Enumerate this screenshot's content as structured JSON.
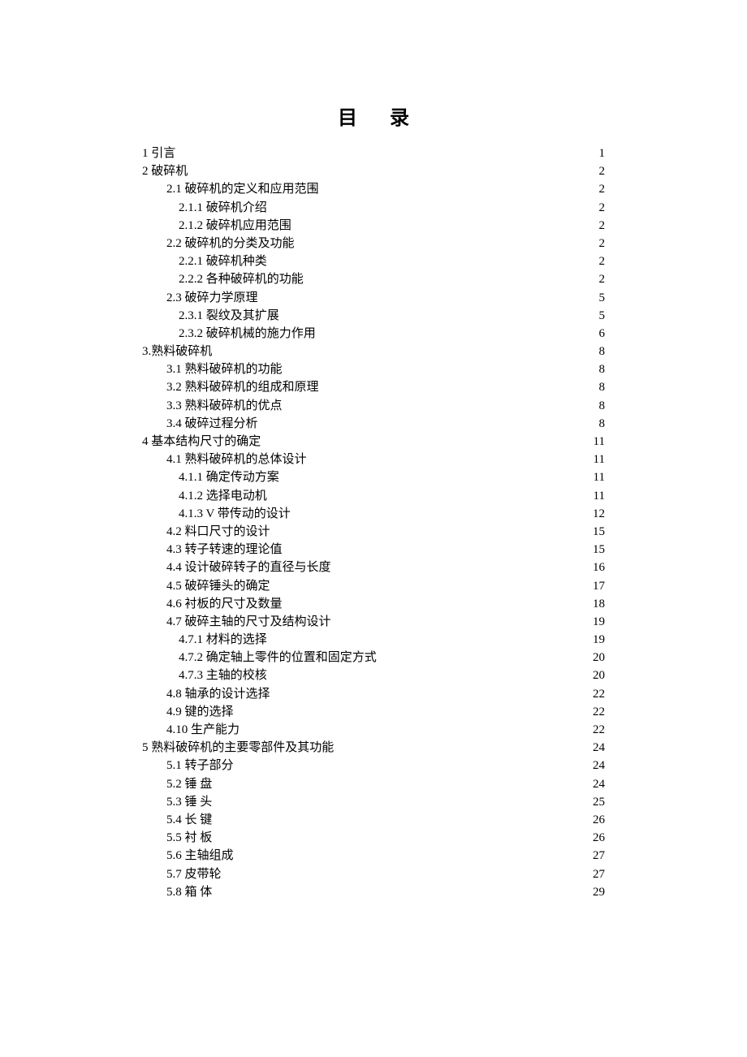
{
  "title": "目录",
  "entries": [
    {
      "level": 0,
      "label": "1 引言",
      "page": "1"
    },
    {
      "level": 0,
      "label": "2 破碎机",
      "page": "2"
    },
    {
      "level": 1,
      "label": "2.1 破碎机的定义和应用范围",
      "page": "2"
    },
    {
      "level": 2,
      "label": "2.1.1 破碎机介绍",
      "page": "2"
    },
    {
      "level": 2,
      "label": "2.1.2 破碎机应用范围",
      "page": "2"
    },
    {
      "level": 1,
      "label": "2.2 破碎机的分类及功能",
      "page": "2"
    },
    {
      "level": 2,
      "label": "2.2.1 破碎机种类",
      "page": "2"
    },
    {
      "level": 2,
      "label": "2.2.2 各种破碎机的功能",
      "page": "2"
    },
    {
      "level": 1,
      "label": "2.3 破碎力学原理",
      "page": "5"
    },
    {
      "level": 2,
      "label": "2.3.1 裂纹及其扩展",
      "page": "5"
    },
    {
      "level": 2,
      "label": "2.3.2 破碎机械的施力作用",
      "page": "6"
    },
    {
      "level": 0,
      "label": "3.熟料破碎机",
      "page": "8"
    },
    {
      "level": 1,
      "label": "3.1 熟料破碎机的功能",
      "page": "8"
    },
    {
      "level": 1,
      "label": "3.2 熟料破碎机的组成和原理",
      "page": "8"
    },
    {
      "level": 1,
      "label": "3.3 熟料破碎机的优点",
      "page": "8"
    },
    {
      "level": 1,
      "label": "3.4 破碎过程分析",
      "page": "8"
    },
    {
      "level": 0,
      "label": "4 基本结构尺寸的确定",
      "page": "11"
    },
    {
      "level": 1,
      "label": "4.1 熟料破碎机的总体设计",
      "page": "11"
    },
    {
      "level": 2,
      "label": "4.1.1  确定传动方案",
      "page": "11"
    },
    {
      "level": 2,
      "label": "4.1.2 选择电动机",
      "page": "11"
    },
    {
      "level": 2,
      "label": "4.1.3 V 带传动的设计",
      "page": "12"
    },
    {
      "level": 1,
      "label": "4.2 料口尺寸的设计",
      "page": "15"
    },
    {
      "level": 1,
      "label": "4.3 转子转速的理论值",
      "page": "15"
    },
    {
      "level": 1,
      "label": "4.4 设计破碎转子的直径与长度",
      "page": "16"
    },
    {
      "level": 1,
      "label": "4.5 破碎锤头的确定",
      "page": "17"
    },
    {
      "level": 1,
      "label": "4.6 衬板的尺寸及数量",
      "page": "18"
    },
    {
      "level": 1,
      "label": "4.7 破碎主轴的尺寸及结构设计",
      "page": "19"
    },
    {
      "level": 2,
      "label": "4.7.1 材料的选择",
      "page": "19"
    },
    {
      "level": 2,
      "label": "4.7.2 确定轴上零件的位置和固定方式",
      "page": "20"
    },
    {
      "level": 2,
      "label": "4.7.3 主轴的校核",
      "page": "20"
    },
    {
      "level": 1,
      "label": "4.8 轴承的设计选择",
      "page": "22"
    },
    {
      "level": 1,
      "label": "4.9 键的选择",
      "page": "22"
    },
    {
      "level": 1,
      "label": "4.10 生产能力",
      "page": "22"
    },
    {
      "level": 0,
      "label": "5 熟料破碎机的主要零部件及其功能",
      "page": "24"
    },
    {
      "level": 1,
      "label": "5.1 转子部分",
      "page": "24"
    },
    {
      "level": 1,
      "label": "5.2 锤    盘",
      "page": "24"
    },
    {
      "level": 1,
      "label": "5.3 锤    头",
      "page": "25"
    },
    {
      "level": 1,
      "label": "5.4 长    键",
      "page": "26"
    },
    {
      "level": 1,
      "label": "5.5 衬    板",
      "page": "26"
    },
    {
      "level": 1,
      "label": "5.6 主轴组成",
      "page": "27"
    },
    {
      "level": 1,
      "label": "5.7 皮带轮",
      "page": "27"
    },
    {
      "level": 1,
      "label": "5.8 箱    体",
      "page": "29"
    }
  ]
}
